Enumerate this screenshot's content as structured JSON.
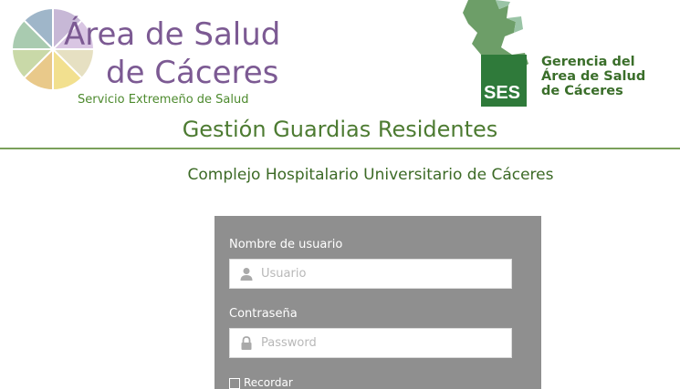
{
  "header": {
    "left_logo": {
      "line1": "Área de Salud",
      "line2": "de Cáceres",
      "subtitle": "Servicio Extremeño de Salud"
    },
    "right_logo": {
      "badge": "SES",
      "line1": "Gerencia del",
      "line2": "Área de Salud",
      "line3": "de Cáceres"
    }
  },
  "page": {
    "title": "Gestión Guardias Residentes",
    "subtitle": "Complejo Hospitalario Universitario de Cáceres"
  },
  "login": {
    "username_label": "Nombre de usuario",
    "username_placeholder": "Usuario",
    "username_value": "",
    "password_label": "Contraseña",
    "password_placeholder": "Password",
    "password_value": "",
    "remember_label": "Recordar"
  },
  "icons": {
    "user": "user-icon",
    "lock": "lock-icon"
  },
  "colors": {
    "brand_purple": "#7c5a93",
    "brand_green": "#4d7b32",
    "panel_gray": "#8f8f8f"
  }
}
